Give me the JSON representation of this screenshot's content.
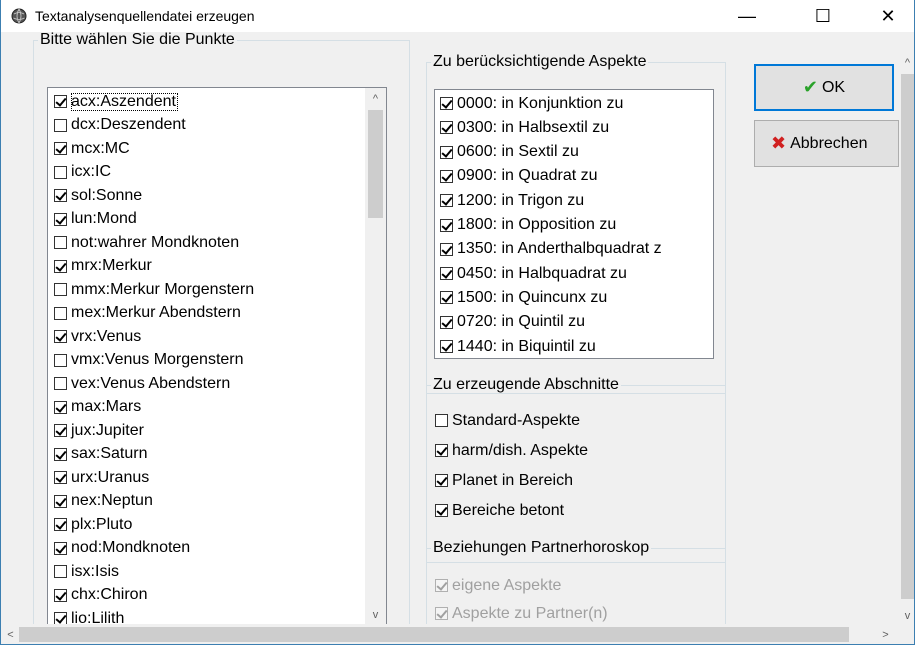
{
  "window": {
    "title": "Textanalysenquellendatei erzeugen",
    "minimize_glyph": "—",
    "maximize_glyph": "☐",
    "close_glyph": "✕"
  },
  "points_group": {
    "legend": "Bitte wählen Sie die Punkte",
    "items": [
      {
        "label": "acx:Aszendent",
        "checked": true
      },
      {
        "label": "dcx:Deszendent",
        "checked": false
      },
      {
        "label": "mcx:MC",
        "checked": true
      },
      {
        "label": "icx:IC",
        "checked": false
      },
      {
        "label": "sol:Sonne",
        "checked": true
      },
      {
        "label": "lun:Mond",
        "checked": true
      },
      {
        "label": "not:wahrer Mondknoten",
        "checked": false
      },
      {
        "label": "mrx:Merkur",
        "checked": true
      },
      {
        "label": "mmx:Merkur Morgenstern",
        "checked": false
      },
      {
        "label": "mex:Merkur Abendstern",
        "checked": false
      },
      {
        "label": "vrx:Venus",
        "checked": true
      },
      {
        "label": "vmx:Venus Morgenstern",
        "checked": false
      },
      {
        "label": "vex:Venus Abendstern",
        "checked": false
      },
      {
        "label": "max:Mars",
        "checked": true
      },
      {
        "label": "jux:Jupiter",
        "checked": true
      },
      {
        "label": "sax:Saturn",
        "checked": true
      },
      {
        "label": "urx:Uranus",
        "checked": true
      },
      {
        "label": "nex:Neptun",
        "checked": true
      },
      {
        "label": "plx:Pluto",
        "checked": true
      },
      {
        "label": "nod:Mondknoten",
        "checked": true
      },
      {
        "label": "isx:Isis",
        "checked": false
      },
      {
        "label": "chx:Chiron",
        "checked": true
      },
      {
        "label": "lio:Lilith",
        "checked": true
      }
    ]
  },
  "aspects_group": {
    "legend": "Zu berücksichtigende Aspekte",
    "items": [
      {
        "label": "0000: in Konjunktion zu",
        "checked": true
      },
      {
        "label": "0300: in Halbsextil zu",
        "checked": true
      },
      {
        "label": "0600: in Sextil zu",
        "checked": true
      },
      {
        "label": "0900: in Quadrat zu",
        "checked": true
      },
      {
        "label": "1200: in Trigon zu",
        "checked": true
      },
      {
        "label": "1800: in Opposition zu",
        "checked": true
      },
      {
        "label": "1350: in Anderthalbquadrat z",
        "checked": true
      },
      {
        "label": "0450: in Halbquadrat zu",
        "checked": true
      },
      {
        "label": "1500: in Quincunx zu",
        "checked": true
      },
      {
        "label": "0720: in Quintil zu",
        "checked": true
      },
      {
        "label": "1440: in Biquintil zu",
        "checked": true
      }
    ]
  },
  "sections_group": {
    "legend": "Zu erzeugende Abschnitte",
    "items": [
      {
        "label": "Standard-Aspekte",
        "checked": false
      },
      {
        "label": "harm/dish. Aspekte",
        "checked": true
      },
      {
        "label": "Planet in Bereich",
        "checked": true
      },
      {
        "label": "Bereiche betont",
        "checked": true
      }
    ]
  },
  "partner_group": {
    "legend": "Beziehungen Partnerhoroskop",
    "items": [
      {
        "label": "eigene Aspekte",
        "checked": true,
        "disabled": true
      },
      {
        "label": "Aspekte zu Partner(n)",
        "checked": true,
        "disabled": true
      }
    ]
  },
  "buttons": {
    "ok_label": "OK",
    "cancel_label": "Abbrechen"
  },
  "scroll_glyphs": {
    "up": "^",
    "down": "v",
    "left": "<",
    "right": ">"
  },
  "colors": {
    "accent": "#0078d7",
    "ok_icon": "#2aa22a",
    "cancel_icon": "#d02020"
  }
}
